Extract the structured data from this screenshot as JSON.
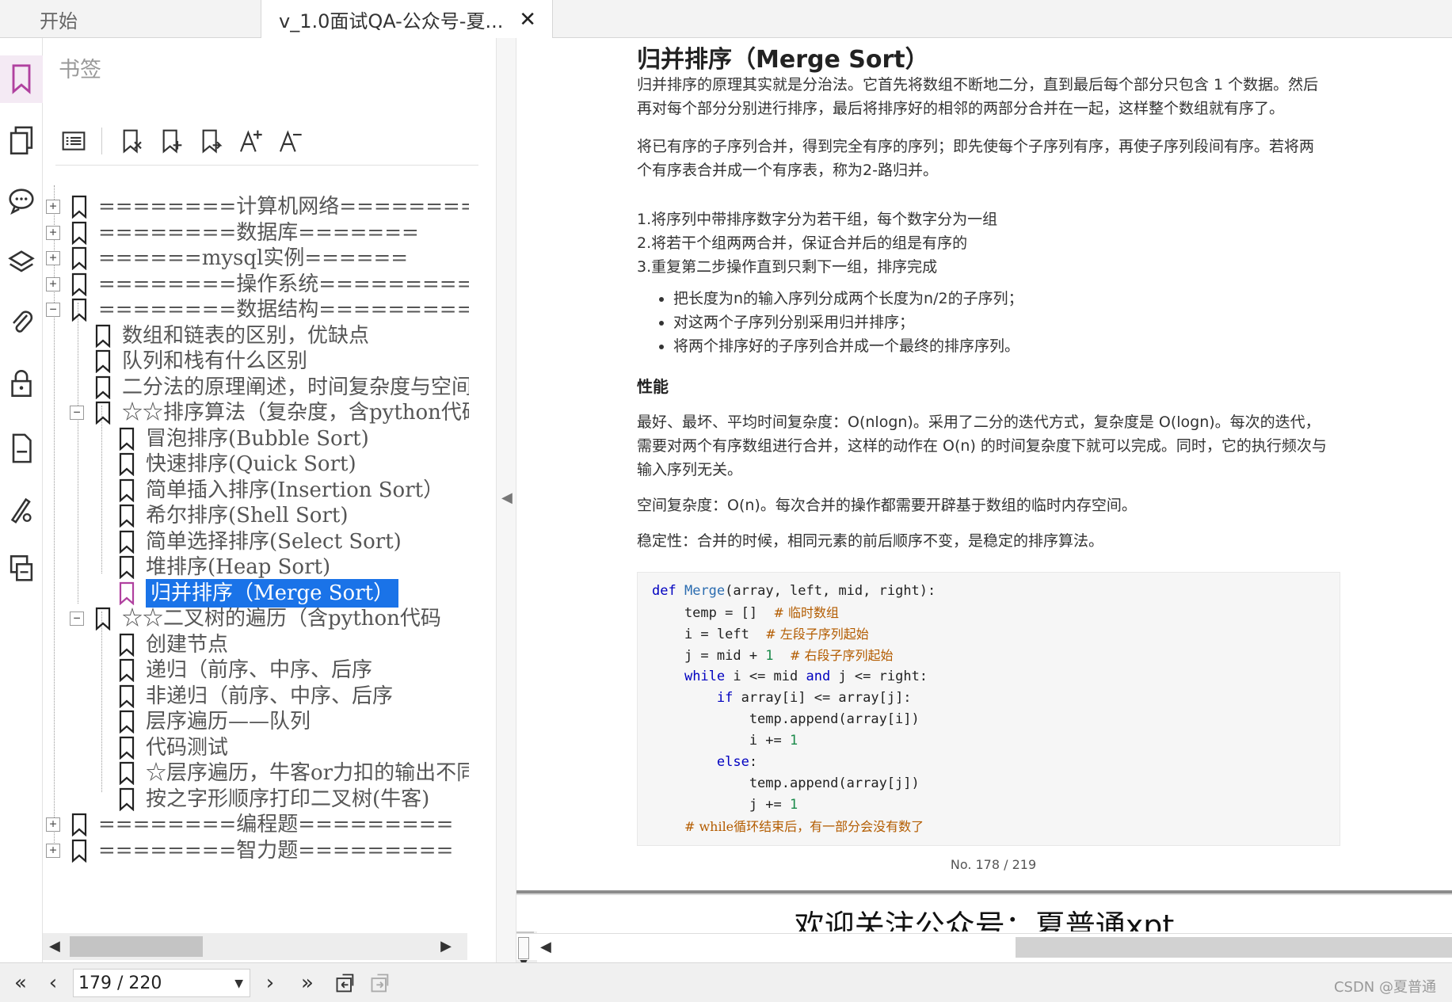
{
  "tabs": [
    {
      "label": "开始"
    },
    {
      "label": "v_1.0面试QA-公众号-夏..."
    }
  ],
  "tab_close": "✕",
  "panel": {
    "title": "书签"
  },
  "tree": [
    {
      "label": "========计算机网络========",
      "expander": "+"
    },
    {
      "label": "========数据库=======",
      "expander": "+"
    },
    {
      "label": "======mysql实例======",
      "expander": "+"
    },
    {
      "label": "========操作系统==========",
      "expander": "+"
    },
    {
      "label": "========数据结构==========",
      "expander": "−"
    },
    {
      "label": "数组和链表的区别，优缺点"
    },
    {
      "label": "队列和栈有什么区别"
    },
    {
      "label": "二分法的原理阐述，时间复杂度与空间"
    },
    {
      "label": "☆☆排序算法（复杂度，含python代码",
      "expander": "−"
    },
    {
      "label": "冒泡排序(Bubble Sort)"
    },
    {
      "label": "快速排序(Quick Sort)"
    },
    {
      "label": "简单插入排序(Insertion Sort）"
    },
    {
      "label": "希尔排序(Shell Sort)"
    },
    {
      "label": "简单选择排序(Select Sort)"
    },
    {
      "label": "堆排序(Heap Sort)"
    },
    {
      "label": "归并排序（Merge Sort）",
      "selected": true
    },
    {
      "label": "☆☆二叉树的遍历（含python代码",
      "expander": "−"
    },
    {
      "label": "创建节点"
    },
    {
      "label": "递归（前序、中序、后序"
    },
    {
      "label": "非递归（前序、中序、后序"
    },
    {
      "label": "层序遍历——队列"
    },
    {
      "label": "代码测试"
    },
    {
      "label": "☆层序遍历，牛客or力扣的输出不同"
    },
    {
      "label": "按之字形顺序打印二叉树(牛客)"
    },
    {
      "label": "========编程题=========",
      "expander": "+"
    },
    {
      "label": "========智力题=========",
      "expander": "+"
    }
  ],
  "doc": {
    "title": "归并排序（Merge Sort）",
    "p1a": "归并排序的原理其实就是分治法。它首先将数组不断地二分，直到最后每个部分只包含 1 个数据。然后",
    "p1b": "再对每个部分分别进行排序，最后将排序好的相邻的两部分合并在一起，这样整个数组就有序了。",
    "p2a": "将已有序的子序列合并，得到完全有序的序列；即先使每个子序列有序，再使子序列段间有序。若将两",
    "p2b": "个有序表合并成一个有序表，称为2-路归并。",
    "steps": [
      "1.将序列中带排序数字分为若干组，每个数字分为一组",
      "2.将若干个组两两合并，保证合并后的组是有序的",
      "3.重复第二步操作直到只剩下一组，排序完成"
    ],
    "bullets": [
      "把长度为n的输入序列分成两个长度为n/2的子序列；",
      "对这两个子序列分别采用归并排序；",
      "将两个排序好的子序列合并成一个最终的排序序列。"
    ],
    "perf_heading": "性能",
    "perf_a": "最好、最坏、平均时间复杂度：O(nlogn)。采用了二分的迭代方式，复杂度是 O(logn)。每次的迭代，",
    "perf_b": "需要对两个有序数组进行合并，这样的动作在 O(n) 的时间复杂度下就可以完成。同时，它的执行频次与",
    "perf_c": "输入序列无关。",
    "space": "空间复杂度：O(n)。每次合并的操作都需要开辟基于数组的临时内存空间。",
    "stability": "稳定性：合并的时候，相同元素的前后顺序不变，是稳定的排序算法。",
    "page_no": "No. 178 / 219",
    "next_page_text": "欢迎关注公众号：夏普通xpt"
  },
  "code": {
    "l1_def": "def",
    "l1_fn": "Merge",
    "l1_rest": "(array, left, mid, right):",
    "l2_code": "    temp = []  ",
    "l2_cm": "# 临时数组",
    "l3_code": "    i = left  ",
    "l3_cm": "# 左段子序列起始",
    "l4_code": "    j = mid + ",
    "l4_num": "1",
    "l4_sp": "  ",
    "l4_cm": "# 右段子序列起始",
    "l5_ind": "    ",
    "l5_kw": "while",
    "l5_a": " i <= mid ",
    "l5_kw2": "and",
    "l5_b": " j <= right:",
    "l6_ind": "        ",
    "l6_kw": "if",
    "l6_rest": " array[i] <= array[j]:",
    "l7": "            temp.append(array[i])",
    "l8_code": "            i += ",
    "l8_num": "1",
    "l9_ind": "        ",
    "l9_kw": "else",
    "l9_rest": ":",
    "l10": "            temp.append(array[j])",
    "l11_code": "            j += ",
    "l11_num": "1",
    "l12_ind": "    ",
    "l12_cm": "# while循环结束后，有一部分会没有数了"
  },
  "nav": {
    "first": "«",
    "prev": "‹",
    "page_field": "179 / 220",
    "next": "›",
    "last": "»",
    "watermark": "CSDN @夏普通"
  },
  "colors": {
    "selection": "#1a73e8",
    "bookmark_active": "#b0419f",
    "keyword": "#0000c0",
    "comment": "#b35c00",
    "number": "#1a8a4a"
  },
  "icons": {
    "rail": [
      "bookmark-icon",
      "pages-icon",
      "comment-icon",
      "layers-icon",
      "attachment-icon",
      "lock-icon",
      "document-icon",
      "signature-icon",
      "compare-icon"
    ],
    "toolbar": [
      "outline-icon",
      "delete-bookmark-icon",
      "add-bookmark-icon",
      "add-child-bookmark-icon",
      "increase-font-icon",
      "decrease-font-icon"
    ]
  }
}
